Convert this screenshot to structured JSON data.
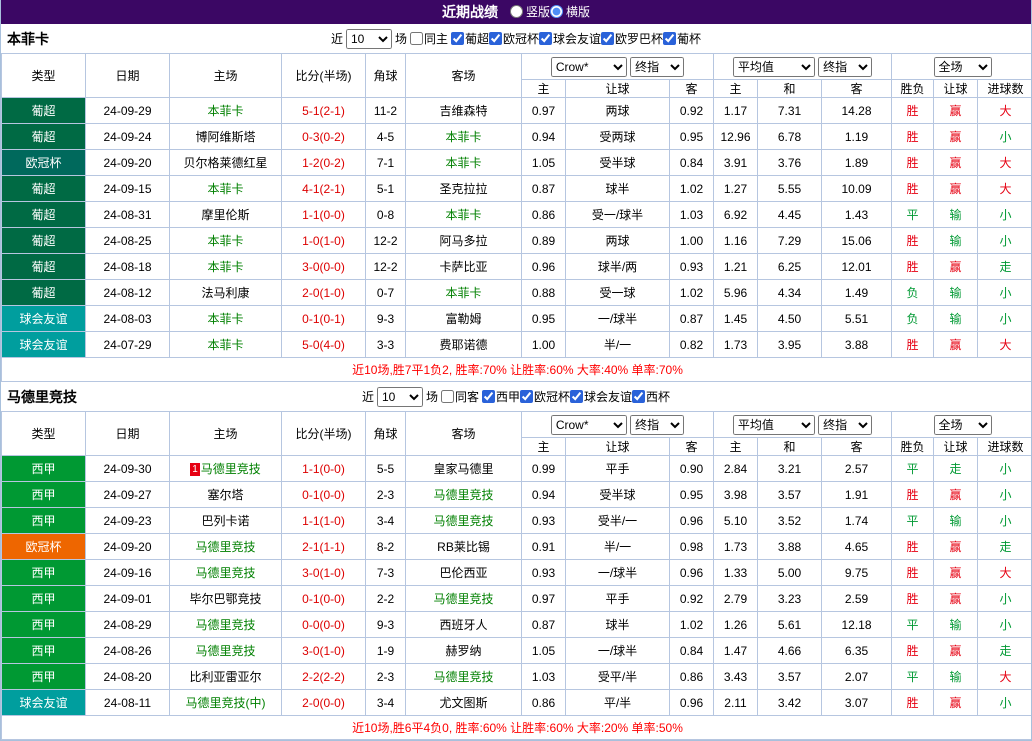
{
  "page": {
    "title": "近期战绩",
    "view_options": [
      {
        "label": "竖版",
        "selected": false
      },
      {
        "label": "横版",
        "selected": true
      }
    ]
  },
  "palette": {
    "bar-bg": "#3B0764",
    "border": "#b6c6e0",
    "team-green": "#008000",
    "score-red": "#dd0000",
    "res-red": "#e60012",
    "res-green": "#009933",
    "summary-red": "#ff0000"
  },
  "tables": [
    {
      "team": "本菲卡",
      "filter": {
        "prefix": "近",
        "count": "10",
        "suffix": "场",
        "same": {
          "label": "同主",
          "checked": false
        },
        "leagues": [
          {
            "label": "葡超",
            "checked": true
          },
          {
            "label": "欧冠杯",
            "checked": true
          },
          {
            "label": "球会友谊",
            "checked": true
          },
          {
            "label": "欧罗巴杯",
            "checked": true
          },
          {
            "label": "葡杯",
            "checked": true
          }
        ]
      },
      "columns": {
        "type": "类型",
        "date": "日期",
        "home": "主场",
        "score": "比分(半场)",
        "corner": "角球",
        "away": "客场",
        "odds_home": "主",
        "handicap": "让球",
        "odds_away": "客",
        "avg_home": "主",
        "avg_draw": "和",
        "avg_away": "客",
        "winloss": "胜负",
        "handicap_result": "让球",
        "goals": "进球数"
      },
      "selects": {
        "source": "Crow*",
        "source_kind": "终指",
        "average": "平均值",
        "average_kind": "终指",
        "scope": "全场"
      },
      "rows": [
        {
          "league": "葡超",
          "color": "#006A44",
          "date": "24-09-29",
          "home": {
            "name": "本菲卡",
            "team": true
          },
          "score": "5-1(2-1)",
          "corner": "11-2",
          "away": {
            "name": "吉维森特"
          },
          "odds": [
            "0.97",
            "两球",
            "0.92"
          ],
          "avg": [
            "1.17",
            "7.31",
            "14.28"
          ],
          "results": [
            [
              "胜",
              "r"
            ],
            [
              "赢",
              "r"
            ],
            [
              "大",
              "r"
            ]
          ]
        },
        {
          "league": "葡超",
          "color": "#006A44",
          "date": "24-09-24",
          "home": {
            "name": "博阿维斯塔"
          },
          "score": "0-3(0-2)",
          "corner": "4-5",
          "away": {
            "name": "本菲卡",
            "team": true
          },
          "odds": [
            "0.94",
            "受两球",
            "0.95"
          ],
          "avg": [
            "12.96",
            "6.78",
            "1.19"
          ],
          "results": [
            [
              "胜",
              "r"
            ],
            [
              "赢",
              "r"
            ],
            [
              "小",
              "g"
            ]
          ]
        },
        {
          "league": "欧冠杯",
          "color": "#00695C",
          "date": "24-09-20",
          "home": {
            "name": "贝尔格莱德红星"
          },
          "score": "1-2(0-2)",
          "corner": "7-1",
          "away": {
            "name": "本菲卡",
            "team": true
          },
          "odds": [
            "1.05",
            "受半球",
            "0.84"
          ],
          "avg": [
            "3.91",
            "3.76",
            "1.89"
          ],
          "results": [
            [
              "胜",
              "r"
            ],
            [
              "赢",
              "r"
            ],
            [
              "大",
              "r"
            ]
          ]
        },
        {
          "league": "葡超",
          "color": "#006A44",
          "date": "24-09-15",
          "home": {
            "name": "本菲卡",
            "team": true
          },
          "score": "4-1(2-1)",
          "corner": "5-1",
          "away": {
            "name": "圣克拉拉"
          },
          "odds": [
            "0.87",
            "球半",
            "1.02"
          ],
          "avg": [
            "1.27",
            "5.55",
            "10.09"
          ],
          "results": [
            [
              "胜",
              "r"
            ],
            [
              "赢",
              "r"
            ],
            [
              "大",
              "r"
            ]
          ]
        },
        {
          "league": "葡超",
          "color": "#006A44",
          "date": "24-08-31",
          "home": {
            "name": "摩里伦斯"
          },
          "score": "1-1(0-0)",
          "corner": "0-8",
          "away": {
            "name": "本菲卡",
            "team": true
          },
          "odds": [
            "0.86",
            "受一/球半",
            "1.03"
          ],
          "avg": [
            "6.92",
            "4.45",
            "1.43"
          ],
          "results": [
            [
              "平",
              "g"
            ],
            [
              "输",
              "g"
            ],
            [
              "小",
              "g"
            ]
          ]
        },
        {
          "league": "葡超",
          "color": "#006A44",
          "date": "24-08-25",
          "home": {
            "name": "本菲卡",
            "team": true
          },
          "score": "1-0(1-0)",
          "corner": "12-2",
          "away": {
            "name": "阿马多拉"
          },
          "odds": [
            "0.89",
            "两球",
            "1.00"
          ],
          "avg": [
            "1.16",
            "7.29",
            "15.06"
          ],
          "results": [
            [
              "胜",
              "r"
            ],
            [
              "输",
              "g"
            ],
            [
              "小",
              "g"
            ]
          ]
        },
        {
          "league": "葡超",
          "color": "#006A44",
          "date": "24-08-18",
          "home": {
            "name": "本菲卡",
            "team": true
          },
          "score": "3-0(0-0)",
          "corner": "12-2",
          "away": {
            "name": "卡萨比亚"
          },
          "odds": [
            "0.96",
            "球半/两",
            "0.93"
          ],
          "avg": [
            "1.21",
            "6.25",
            "12.01"
          ],
          "results": [
            [
              "胜",
              "r"
            ],
            [
              "赢",
              "r"
            ],
            [
              "走",
              "g"
            ]
          ]
        },
        {
          "league": "葡超",
          "color": "#006A44",
          "date": "24-08-12",
          "home": {
            "name": "法马利康"
          },
          "score": "2-0(1-0)",
          "corner": "0-7",
          "away": {
            "name": "本菲卡",
            "team": true
          },
          "odds": [
            "0.88",
            "受一球",
            "1.02"
          ],
          "avg": [
            "5.96",
            "4.34",
            "1.49"
          ],
          "results": [
            [
              "负",
              "g"
            ],
            [
              "输",
              "g"
            ],
            [
              "小",
              "g"
            ]
          ]
        },
        {
          "league": "球会友谊",
          "color": "#009E9E",
          "date": "24-08-03",
          "home": {
            "name": "本菲卡",
            "team": true
          },
          "score": "0-1(0-1)",
          "corner": "9-3",
          "away": {
            "name": "富勒姆"
          },
          "odds": [
            "0.95",
            "一/球半",
            "0.87"
          ],
          "avg": [
            "1.45",
            "4.50",
            "5.51"
          ],
          "results": [
            [
              "负",
              "g"
            ],
            [
              "输",
              "g"
            ],
            [
              "小",
              "g"
            ]
          ]
        },
        {
          "league": "球会友谊",
          "color": "#009E9E",
          "date": "24-07-29",
          "home": {
            "name": "本菲卡",
            "team": true
          },
          "score": "5-0(4-0)",
          "corner": "3-3",
          "away": {
            "name": "费耶诺德"
          },
          "odds": [
            "1.00",
            "半/一",
            "0.82"
          ],
          "avg": [
            "1.73",
            "3.95",
            "3.88"
          ],
          "results": [
            [
              "胜",
              "r"
            ],
            [
              "赢",
              "r"
            ],
            [
              "大",
              "r"
            ]
          ]
        }
      ],
      "summary": "近10场,胜7平1负2, 胜率:70% 让胜率:60% 大率:40% 单率:70%"
    },
    {
      "team": "马德里竞技",
      "filter": {
        "prefix": "近",
        "count": "10",
        "suffix": "场",
        "same": {
          "label": "同客",
          "checked": false
        },
        "leagues": [
          {
            "label": "西甲",
            "checked": true
          },
          {
            "label": "欧冠杯",
            "checked": true
          },
          {
            "label": "球会友谊",
            "checked": true
          },
          {
            "label": "西杯",
            "checked": true
          }
        ]
      },
      "columns": {
        "type": "类型",
        "date": "日期",
        "home": "主场",
        "score": "比分(半场)",
        "corner": "角球",
        "away": "客场",
        "odds_home": "主",
        "handicap": "让球",
        "odds_away": "客",
        "avg_home": "主",
        "avg_draw": "和",
        "avg_away": "客",
        "winloss": "胜负",
        "handicap_result": "让球",
        "goals": "进球数"
      },
      "selects": {
        "source": "Crow*",
        "source_kind": "终指",
        "average": "平均值",
        "average_kind": "终指",
        "scope": "全场"
      },
      "rows": [
        {
          "league": "西甲",
          "color": "#009933",
          "date": "24-09-30",
          "home": {
            "name": "马德里竞技",
            "team": true,
            "rank": "1"
          },
          "score": "1-1(0-0)",
          "corner": "5-5",
          "away": {
            "name": "皇家马德里"
          },
          "odds": [
            "0.99",
            "平手",
            "0.90"
          ],
          "avg": [
            "2.84",
            "3.21",
            "2.57"
          ],
          "results": [
            [
              "平",
              "g"
            ],
            [
              "走",
              "g"
            ],
            [
              "小",
              "g"
            ]
          ]
        },
        {
          "league": "西甲",
          "color": "#009933",
          "date": "24-09-27",
          "home": {
            "name": "塞尔塔"
          },
          "score": "0-1(0-0)",
          "corner": "2-3",
          "away": {
            "name": "马德里竞技",
            "team": true
          },
          "odds": [
            "0.94",
            "受半球",
            "0.95"
          ],
          "avg": [
            "3.98",
            "3.57",
            "1.91"
          ],
          "results": [
            [
              "胜",
              "r"
            ],
            [
              "赢",
              "r"
            ],
            [
              "小",
              "g"
            ]
          ]
        },
        {
          "league": "西甲",
          "color": "#009933",
          "date": "24-09-23",
          "home": {
            "name": "巴列卡诺"
          },
          "score": "1-1(1-0)",
          "corner": "3-4",
          "away": {
            "name": "马德里竞技",
            "team": true
          },
          "odds": [
            "0.93",
            "受半/一",
            "0.96"
          ],
          "avg": [
            "5.10",
            "3.52",
            "1.74"
          ],
          "results": [
            [
              "平",
              "g"
            ],
            [
              "输",
              "g"
            ],
            [
              "小",
              "g"
            ]
          ]
        },
        {
          "league": "欧冠杯",
          "color": "#EE6600",
          "date": "24-09-20",
          "home": {
            "name": "马德里竞技",
            "team": true
          },
          "score": "2-1(1-1)",
          "corner": "8-2",
          "away": {
            "name": "RB莱比锡"
          },
          "odds": [
            "0.91",
            "半/一",
            "0.98"
          ],
          "avg": [
            "1.73",
            "3.88",
            "4.65"
          ],
          "results": [
            [
              "胜",
              "r"
            ],
            [
              "赢",
              "r"
            ],
            [
              "走",
              "g"
            ]
          ]
        },
        {
          "league": "西甲",
          "color": "#009933",
          "date": "24-09-16",
          "home": {
            "name": "马德里竞技",
            "team": true
          },
          "score": "3-0(1-0)",
          "corner": "7-3",
          "away": {
            "name": "巴伦西亚"
          },
          "odds": [
            "0.93",
            "一/球半",
            "0.96"
          ],
          "avg": [
            "1.33",
            "5.00",
            "9.75"
          ],
          "results": [
            [
              "胜",
              "r"
            ],
            [
              "赢",
              "r"
            ],
            [
              "大",
              "r"
            ]
          ]
        },
        {
          "league": "西甲",
          "color": "#009933",
          "date": "24-09-01",
          "home": {
            "name": "毕尔巴鄂竞技"
          },
          "score": "0-1(0-0)",
          "corner": "2-2",
          "away": {
            "name": "马德里竞技",
            "team": true
          },
          "odds": [
            "0.97",
            "平手",
            "0.92"
          ],
          "avg": [
            "2.79",
            "3.23",
            "2.59"
          ],
          "results": [
            [
              "胜",
              "r"
            ],
            [
              "赢",
              "r"
            ],
            [
              "小",
              "g"
            ]
          ]
        },
        {
          "league": "西甲",
          "color": "#009933",
          "date": "24-08-29",
          "home": {
            "name": "马德里竞技",
            "team": true
          },
          "score": "0-0(0-0)",
          "corner": "9-3",
          "away": {
            "name": "西班牙人"
          },
          "odds": [
            "0.87",
            "球半",
            "1.02"
          ],
          "avg": [
            "1.26",
            "5.61",
            "12.18"
          ],
          "results": [
            [
              "平",
              "g"
            ],
            [
              "输",
              "g"
            ],
            [
              "小",
              "g"
            ]
          ]
        },
        {
          "league": "西甲",
          "color": "#009933",
          "date": "24-08-26",
          "home": {
            "name": "马德里竞技",
            "team": true
          },
          "score": "3-0(1-0)",
          "corner": "1-9",
          "away": {
            "name": "赫罗纳"
          },
          "odds": [
            "1.05",
            "一/球半",
            "0.84"
          ],
          "avg": [
            "1.47",
            "4.66",
            "6.35"
          ],
          "results": [
            [
              "胜",
              "r"
            ],
            [
              "赢",
              "r"
            ],
            [
              "走",
              "g"
            ]
          ]
        },
        {
          "league": "西甲",
          "color": "#009933",
          "date": "24-08-20",
          "home": {
            "name": "比利亚雷亚尔"
          },
          "score": "2-2(2-2)",
          "corner": "2-3",
          "away": {
            "name": "马德里竞技",
            "team": true
          },
          "odds": [
            "1.03",
            "受平/半",
            "0.86"
          ],
          "avg": [
            "3.43",
            "3.57",
            "2.07"
          ],
          "results": [
            [
              "平",
              "g"
            ],
            [
              "输",
              "g"
            ],
            [
              "大",
              "r"
            ]
          ]
        },
        {
          "league": "球会友谊",
          "color": "#009E9E",
          "date": "24-08-11",
          "home": {
            "name": "马德里竞技(中)",
            "team": true
          },
          "score": "2-0(0-0)",
          "corner": "3-4",
          "away": {
            "name": "尤文图斯"
          },
          "odds": [
            "0.86",
            "平/半",
            "0.96"
          ],
          "avg": [
            "2.11",
            "3.42",
            "3.07"
          ],
          "results": [
            [
              "胜",
              "r"
            ],
            [
              "赢",
              "r"
            ],
            [
              "小",
              "g"
            ]
          ]
        }
      ],
      "summary": "近10场,胜6平4负0, 胜率:60% 让胜率:60% 大率:20% 单率:50%"
    }
  ]
}
